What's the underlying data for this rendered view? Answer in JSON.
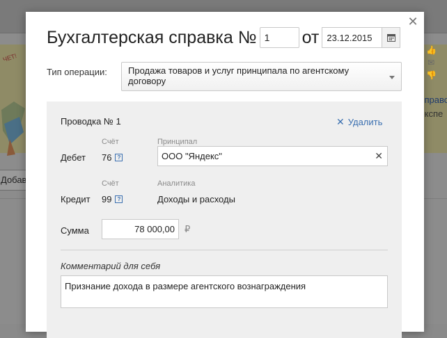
{
  "background": {
    "banner_text_1": "справо",
    "banner_text_2": "экспе",
    "add_button_label": "Добав",
    "banner_sticker": "ЧЕТ!"
  },
  "modal": {
    "title": "Бухгалтерская справка №",
    "number_value": "1",
    "date_prefix": "от",
    "date_value": "23.12.2015",
    "operation_type_label": "Тип операции:",
    "operation_type_value": "Продажа товаров и услуг принципала по агентскому договору",
    "entry": {
      "title": "Проводка № 1",
      "delete_label": "Удалить",
      "account_header": "Счёт",
      "principal_header": "Принципал",
      "debit_label": "Дебет",
      "debit_account": "76",
      "principal_value": "ООО \"Яндекс\"",
      "analytics_header": "Аналитика",
      "credit_label": "Кредит",
      "credit_account": "99",
      "analytics_value": "Доходы и расходы",
      "sum_label": "Сумма",
      "sum_value": "78 000,00",
      "currency": "₽",
      "help_glyph": "?",
      "comment_label": "Комментарий для себя",
      "comment_value": "Признание дохода в размере агентского вознаграждения"
    }
  },
  "colors": {
    "link": "#3a6fb0",
    "panel_bg": "#efefef",
    "overlay": "#8a8a8a"
  },
  "icons": [
    "close-icon",
    "calendar-icon",
    "chevron-down-icon",
    "delete-x-icon",
    "help-icon",
    "clear-icon",
    "thumb-up-icon",
    "mail-icon",
    "thumb-down-icon"
  ]
}
